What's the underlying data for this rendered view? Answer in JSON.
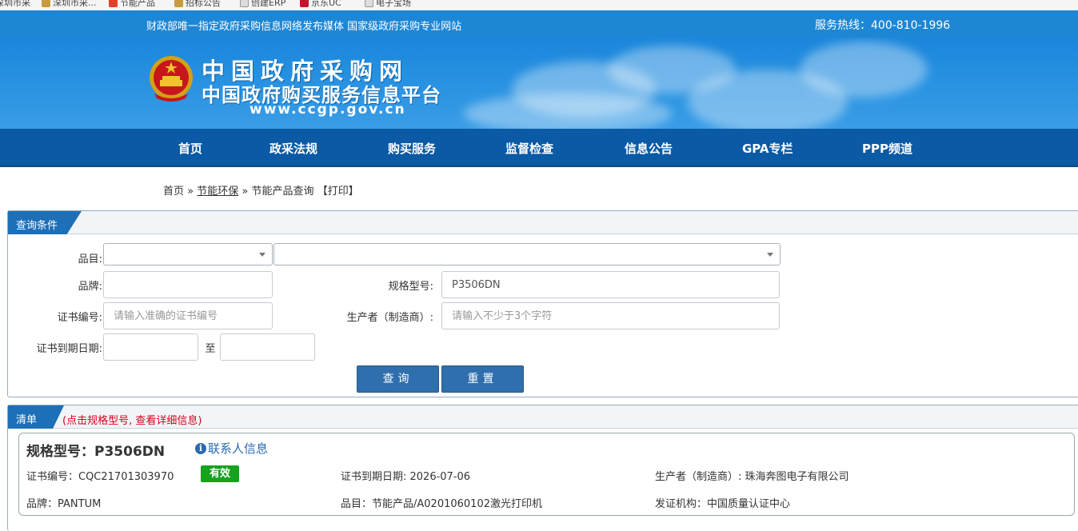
{
  "bookmarks": [
    "深圳市采",
    "深圳市采...",
    "节能产品",
    "招标公告",
    "创建ERP",
    "京东UC",
    "电子宝场"
  ],
  "header": {
    "slogan": "财政部唯一指定政府采购信息网络发布媒体 国家级政府采购专业网站",
    "hotline": "服务热线：400-810-1996"
  },
  "banner": {
    "title1": "中国政府采购网",
    "title2": "中国政府购买服务信息平台",
    "url": "www.ccgp.gov.cn"
  },
  "nav": [
    "首页",
    "政采法规",
    "购买服务",
    "监督检查",
    "信息公告",
    "GPA专栏",
    "PPP频道"
  ],
  "breadcrumb": {
    "home": "首页",
    "sep1": "»",
    "section": "节能环保",
    "sep2": "»",
    "current": "节能产品查询",
    "print": "【打印】"
  },
  "query": {
    "tab": "查询条件",
    "category_label": "品目:",
    "brand_label": "品牌:",
    "model_label": "规格型号:",
    "model_value": "P3506DN",
    "cert_label": "证书编号:",
    "cert_placeholder": "请输入准确的证书编号",
    "maker_label": "生产者（制造商）:",
    "maker_placeholder": "请输入不少于3个字符",
    "expiry_label": "证书到期日期:",
    "to": "至",
    "search_btn": "查询",
    "reset_btn": "重置"
  },
  "list": {
    "tab": "清单",
    "note": "(点击规格型号, 查看详细信息)",
    "item": {
      "title": "规格型号：P3506DN",
      "contact": "联系人信息",
      "cert_no": "证书编号：CQC21701303970",
      "status": "有效",
      "expiry": "证书到期日期: 2026-07-06",
      "maker": "生产者（制造商）: 珠海奔图电子有限公司",
      "brand": "品牌：PANTUM",
      "category": "品目：节能产品/A0201060102激光打印机",
      "issuer": "发证机构：中国质量认证中心"
    }
  },
  "colors": {
    "topbar": "#1d87d6",
    "nav": "#0a5aa5",
    "tab": "#1d6fb8",
    "button": "#2f6fae",
    "valid": "#15a31e",
    "note": "#d9001b"
  }
}
